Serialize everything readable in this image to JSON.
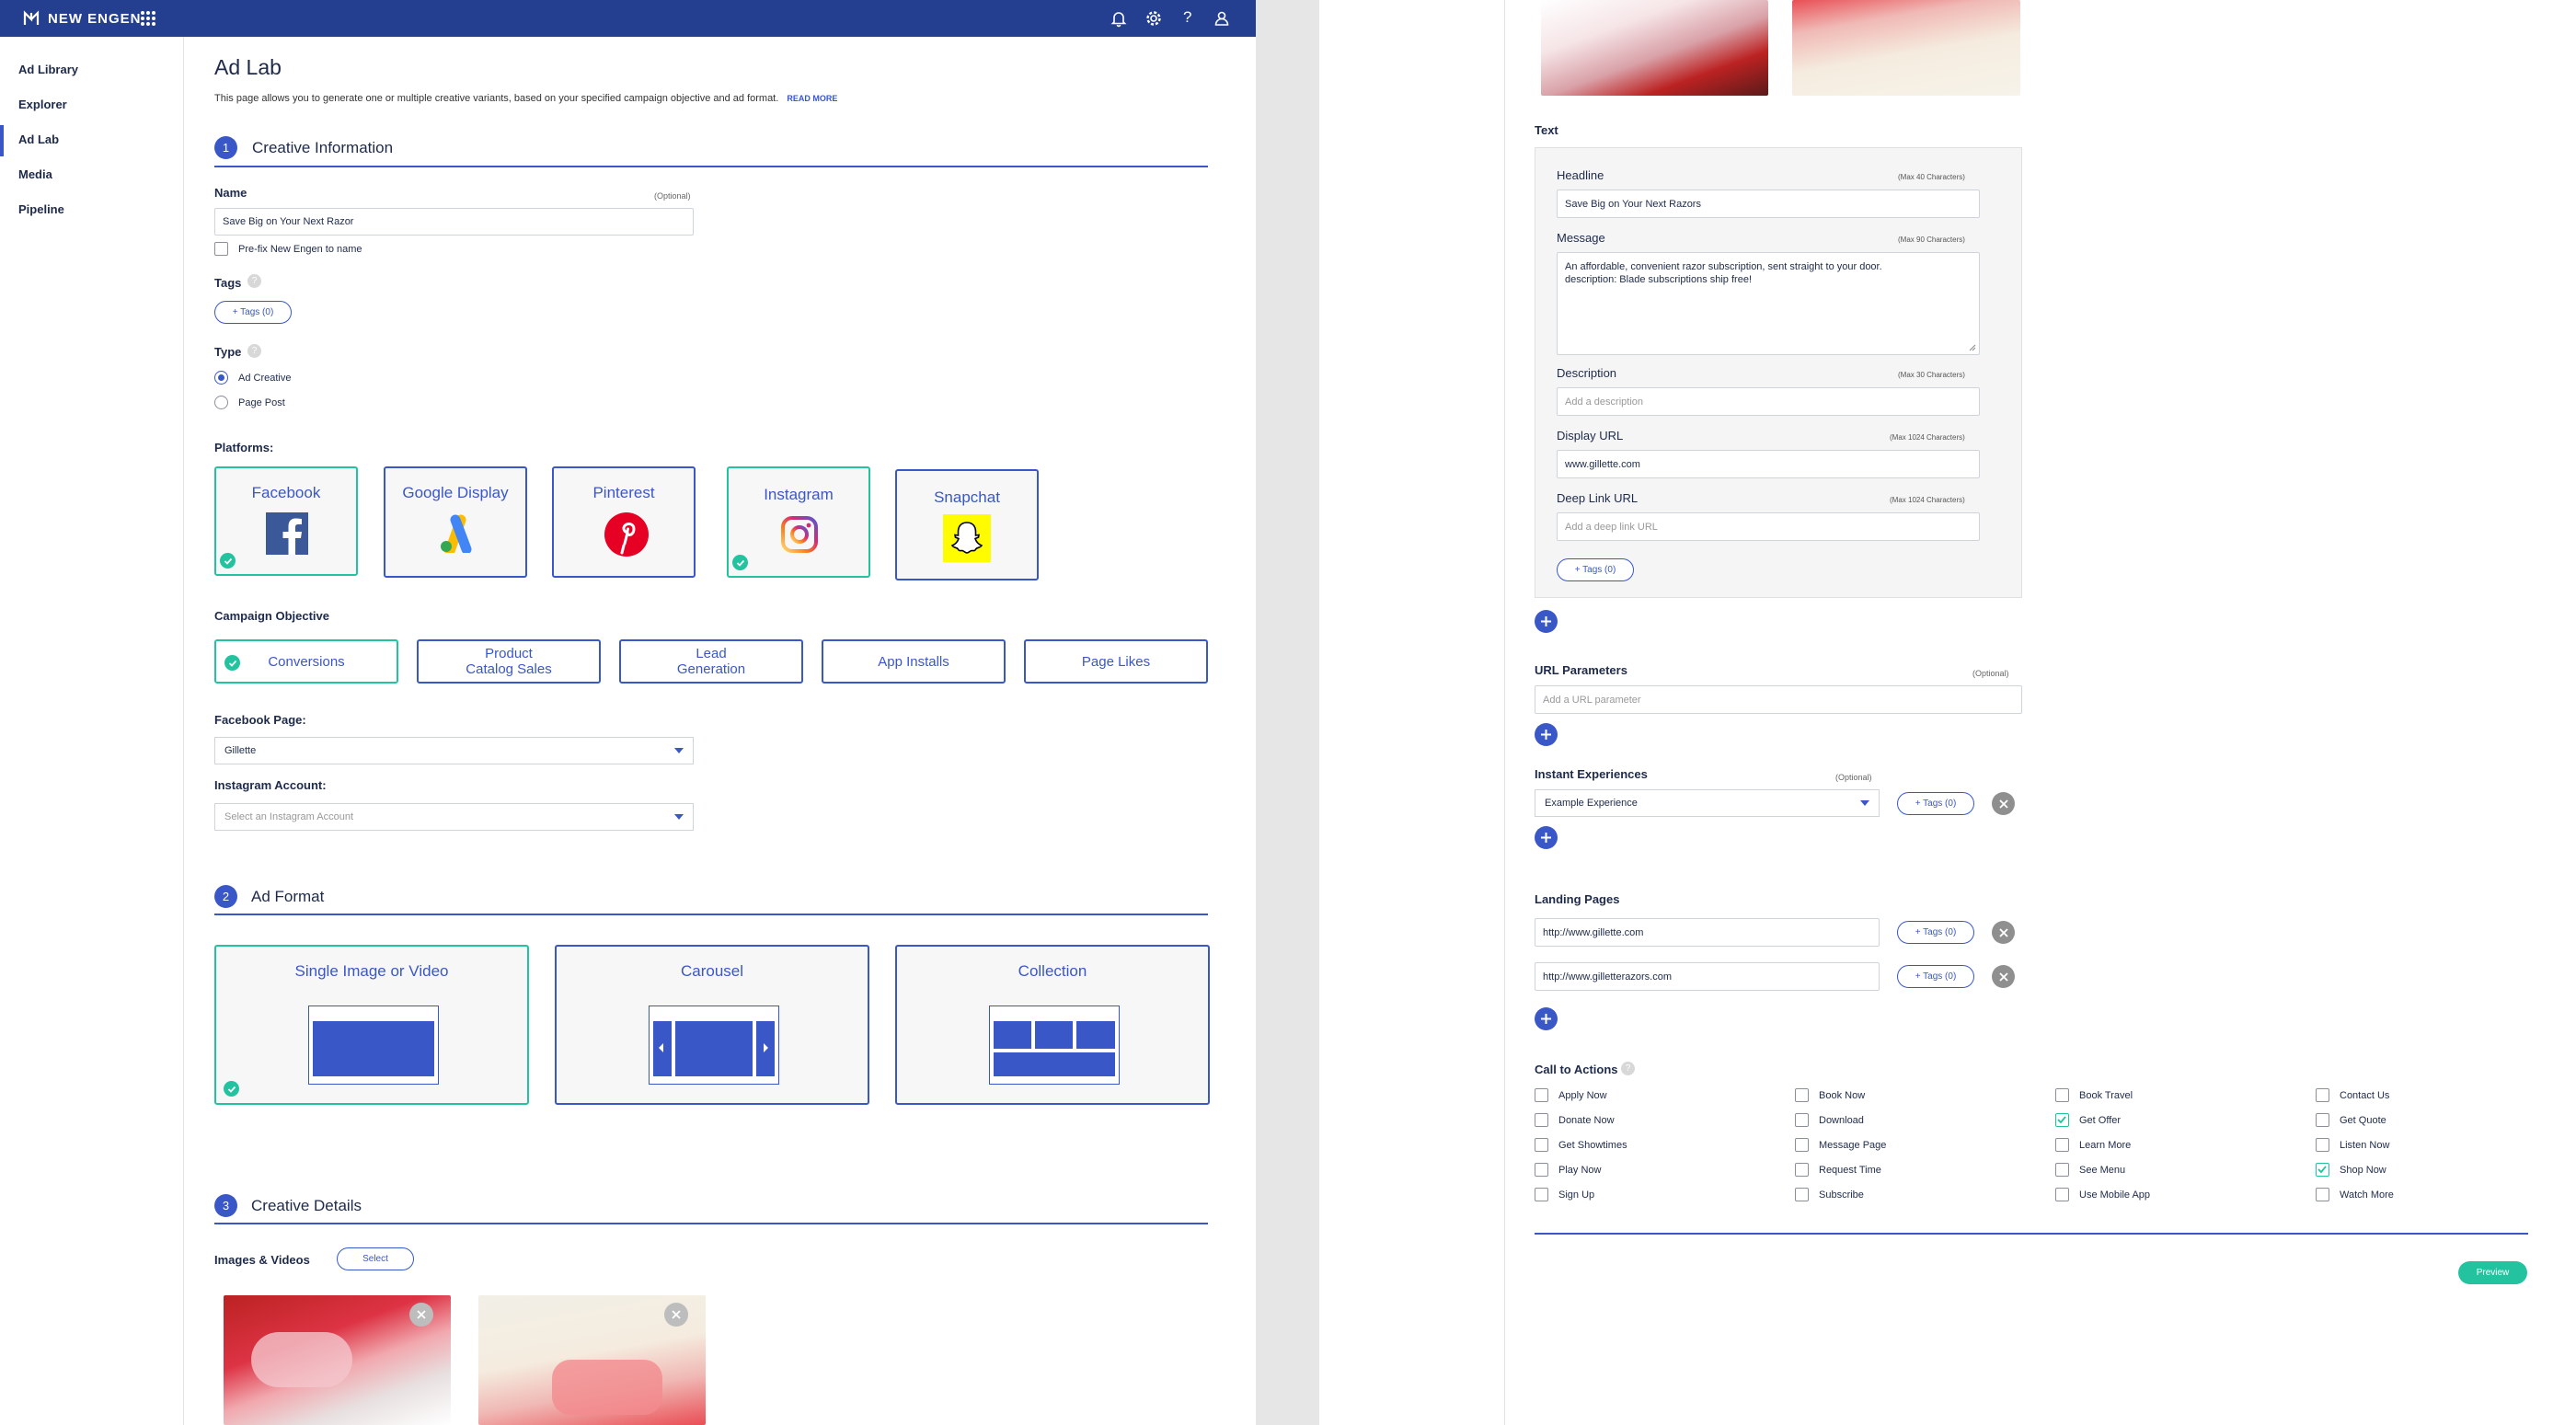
{
  "app": {
    "brand": "NEW ENGEN"
  },
  "sidebar": {
    "items": [
      {
        "label": "Ad Library"
      },
      {
        "label": "Explorer"
      },
      {
        "label": "Ad Lab"
      },
      {
        "label": "Media"
      },
      {
        "label": "Pipeline"
      }
    ],
    "active": "Ad Lab"
  },
  "page": {
    "title": "Ad Lab",
    "subtitle": "This page allows you to generate one or multiple creative variants, based on your specified campaign objective and ad format.",
    "read_more": "READ MORE"
  },
  "section1": {
    "num": "1",
    "title": "Creative Information",
    "name_label": "Name",
    "name_optional": "(Optional)",
    "name_value": "Save Big on  Your Next Razor",
    "prefix_label": "Pre-fix New Engen to name",
    "tags_label": "Tags",
    "tags_button": "+ Tags (0)",
    "type_label": "Type",
    "type_options": [
      "Ad Creative",
      "Page Post"
    ],
    "type_selected": "Ad Creative",
    "platforms_label": "Platforms:",
    "platforms": [
      {
        "label": "Facebook",
        "selected": true
      },
      {
        "label": "Google Display",
        "selected": false
      },
      {
        "label": "Pinterest",
        "selected": false
      },
      {
        "label": "Instagram",
        "selected": true
      },
      {
        "label": "Snapchat",
        "selected": false
      }
    ],
    "objective_label": "Campaign Objective",
    "objectives": [
      {
        "label": "Conversions",
        "selected": true
      },
      {
        "label": "Product\nCatalog Sales",
        "selected": false
      },
      {
        "label": "Lead\nGeneration",
        "selected": false
      },
      {
        "label": "App Installs",
        "selected": false
      },
      {
        "label": "Page Likes",
        "selected": false
      }
    ],
    "fb_page_label": "Facebook Page:",
    "fb_page_value": "Gillette",
    "ig_label": "Instagram Account:",
    "ig_placeholder": "Select an Instagram Account"
  },
  "section2": {
    "num": "2",
    "title": "Ad Format",
    "formats": [
      {
        "label": "Single Image or Video",
        "selected": true
      },
      {
        "label": "Carousel",
        "selected": false
      },
      {
        "label": "Collection",
        "selected": false
      }
    ]
  },
  "section3": {
    "num": "3",
    "title": "Creative Details",
    "images_label": "Images & Videos",
    "select_button": "Select"
  },
  "text": {
    "heading": "Text",
    "headline_label": "Headline",
    "headline_max": "(Max 40 Characters)",
    "headline_value": "Save Big on Your Next Razors",
    "message_label": "Message",
    "message_max": "(Max 90 Characters)",
    "message_line1": "An affordable, convenient razor subscription, sent straight to your door.",
    "message_line2": "description: Blade subscriptions ship free!",
    "description_label": "Description",
    "description_max": "(Max 30 Characters)",
    "description_placeholder": "Add a description",
    "display_url_label": "Display URL",
    "display_url_max": "(Max 1024 Characters)",
    "display_url_value": "www.gillette.com",
    "deep_link_label": "Deep Link URL",
    "deep_link_max": "(Max 1024 Characters)",
    "deep_link_placeholder": "Add a deep link URL",
    "tags_button": "+ Tags (0)"
  },
  "url_params": {
    "label": "URL Parameters",
    "optional": "(Optional)",
    "placeholder": "Add a URL parameter"
  },
  "instant": {
    "label": "Instant Experiences",
    "optional": "(Optional)",
    "value": "Example Experience",
    "tags_button": "+ Tags (0)"
  },
  "landing": {
    "label": "Landing Pages",
    "pages": [
      {
        "url": "http://www.gillette.com",
        "tags_button": "+ Tags (0)"
      },
      {
        "url": "http://www.gilletterazors.com",
        "tags_button": "+ Tags (0)"
      }
    ]
  },
  "cta": {
    "label": "Call to Actions",
    "items": [
      {
        "label": "Apply Now",
        "checked": false
      },
      {
        "label": "Book Now",
        "checked": false
      },
      {
        "label": "Book Travel",
        "checked": false
      },
      {
        "label": "Contact Us",
        "checked": false
      },
      {
        "label": "Donate Now",
        "checked": false
      },
      {
        "label": "Download",
        "checked": false
      },
      {
        "label": "Get Offer",
        "checked": true
      },
      {
        "label": "Get Quote",
        "checked": false
      },
      {
        "label": "Get Showtimes",
        "checked": false
      },
      {
        "label": "Message Page",
        "checked": false
      },
      {
        "label": "Learn More",
        "checked": false
      },
      {
        "label": "Listen Now",
        "checked": false
      },
      {
        "label": "Play Now",
        "checked": false
      },
      {
        "label": "Request Time",
        "checked": false
      },
      {
        "label": "See Menu",
        "checked": false
      },
      {
        "label": "Shop Now",
        "checked": true
      },
      {
        "label": "Sign Up",
        "checked": false
      },
      {
        "label": "Subscribe",
        "checked": false
      },
      {
        "label": "Use Mobile App",
        "checked": false
      },
      {
        "label": "Watch More",
        "checked": false
      }
    ]
  },
  "preview_button": "Preview",
  "colors": {
    "brand": "#243f8f",
    "accent": "#3a57c8",
    "selected": "#24c3a0"
  }
}
